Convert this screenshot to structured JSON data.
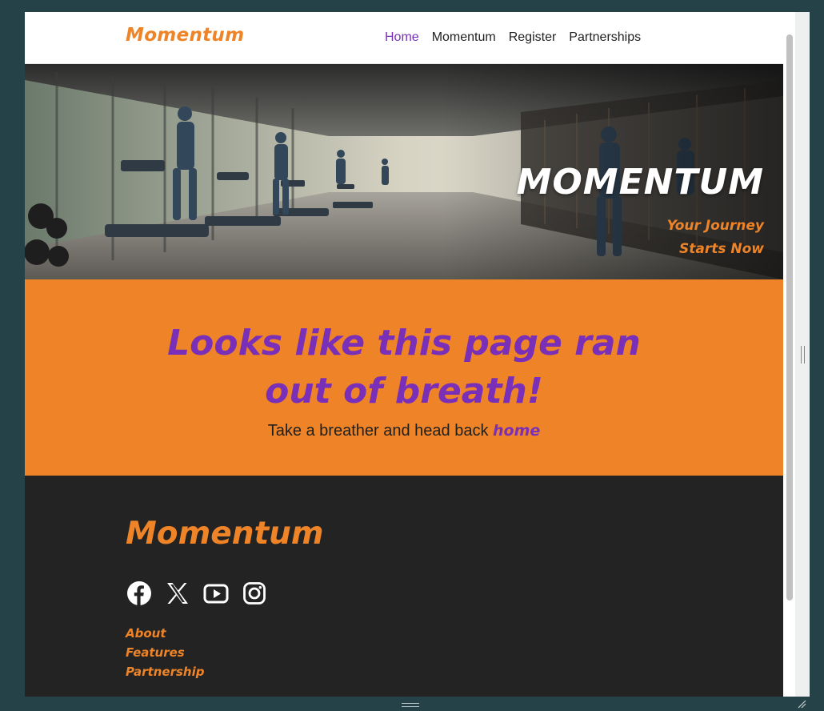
{
  "navbar": {
    "brand": "Momentum",
    "links": [
      {
        "label": "Home",
        "active": true
      },
      {
        "label": "Momentum",
        "active": false
      },
      {
        "label": "Register",
        "active": false
      },
      {
        "label": "Partnerships",
        "active": false
      }
    ]
  },
  "hero": {
    "title": "MOMENTUM",
    "subtitle_line1": "Your Journey",
    "subtitle_line2": "Starts Now"
  },
  "notfound": {
    "heading": "Looks like this page ran out of breath!",
    "text": "Take a breather and head back ",
    "link": "home"
  },
  "footer": {
    "brand": "Momentum",
    "socials": [
      {
        "icon": "facebook-icon"
      },
      {
        "icon": "x-icon"
      },
      {
        "icon": "youtube-icon"
      },
      {
        "icon": "instagram-icon"
      }
    ],
    "links": [
      "About",
      "Features",
      "Partnership"
    ]
  },
  "colors": {
    "accent_orange": "#ee8427",
    "accent_purple": "#7a2fb8",
    "footer_bg": "#232323"
  }
}
